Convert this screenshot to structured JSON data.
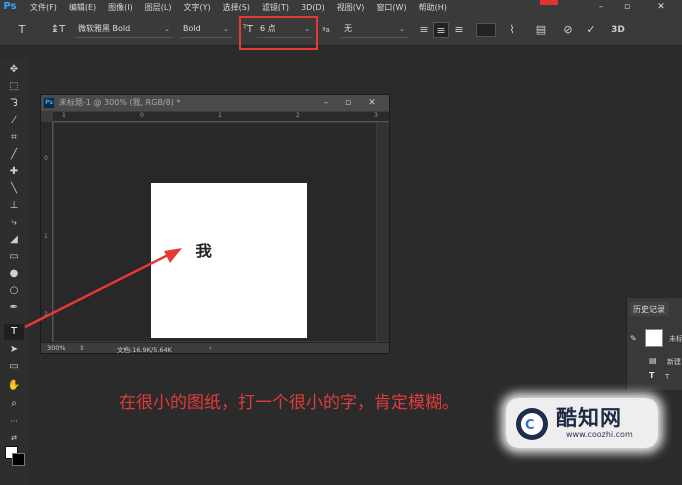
{
  "app": {
    "logo": "Ps"
  },
  "menu": [
    "文件(F)",
    "编辑(E)",
    "图像(I)",
    "图层(L)",
    "文字(Y)",
    "选择(S)",
    "滤镜(T)",
    "3D(D)",
    "视图(V)",
    "窗口(W)",
    "帮助(H)"
  ],
  "options": {
    "font_family": "微软雅黑 Bold",
    "font_style": "Bold",
    "font_size": "6 点",
    "antialias": "无",
    "aa_label": "ªa",
    "mode_3d": "3D"
  },
  "document": {
    "title": "未标题-1 @ 300% (我, RGB/8) *",
    "ruler_h": [
      "1",
      "0",
      "1",
      "2",
      "3"
    ],
    "ruler_v": [
      "0",
      "1",
      "2"
    ],
    "canvas_text": "我",
    "zoom": "300%",
    "doc_info": "文档:16.9K/5.64K",
    "canvas_color": "#ffffff"
  },
  "caption": "在很小的图纸，打一个很小的字，肯定模糊。",
  "history": {
    "tab_label": "历史记录",
    "snapshot_label": "未标",
    "items": [
      "新建",
      "T"
    ]
  },
  "watermark": {
    "title": "酷知网",
    "url": "www.coozhi.com"
  },
  "colors": {
    "annotation_red": "#e53935",
    "ps_blue": "#31a8ff",
    "foreground": "#ffffff",
    "background": "#000000"
  }
}
